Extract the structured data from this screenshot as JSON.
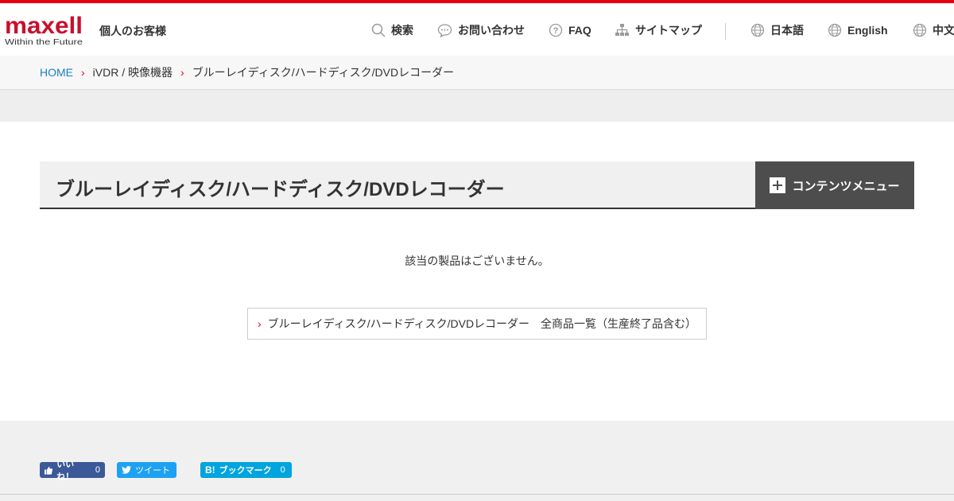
{
  "colors": {
    "accent": "#e60012",
    "link": "#1a7fc1",
    "menu_bg": "#4d4d4d"
  },
  "header": {
    "logo_text": "maxell",
    "logo_tagline": "Within the Future",
    "audience": "個人のお客様",
    "nav": [
      {
        "icon": "search-icon",
        "label": "検索"
      },
      {
        "icon": "chat-bubble-icon",
        "label": "お問い合わせ"
      },
      {
        "icon": "question-icon",
        "label": "FAQ"
      },
      {
        "icon": "sitemap-icon",
        "label": "サイトマップ"
      }
    ],
    "languages": [
      {
        "icon": "globe-icon",
        "label": "日本語"
      },
      {
        "icon": "globe-icon",
        "label": "English"
      },
      {
        "icon": "globe-icon",
        "label": "中文"
      }
    ]
  },
  "breadcrumb": {
    "home": "HOME",
    "category": "iVDR / 映像機器",
    "current": "ブルーレイディスク/ハードディスク/DVDレコーダー"
  },
  "main": {
    "title": "ブルーレイディスク/ハードディスク/DVDレコーダー",
    "menu_button": "コンテンツメニュー",
    "empty_message": "該当の製品はございません。",
    "all_products_link": "ブルーレイディスク/ハードディスク/DVDレコーダー　全商品一覧（生産終了品含む）"
  },
  "share": {
    "facebook_label": "いいね！",
    "facebook_count": "0",
    "twitter_label": "ツイート",
    "hatena_label": "ブックマーク",
    "hatena_count": "0"
  }
}
